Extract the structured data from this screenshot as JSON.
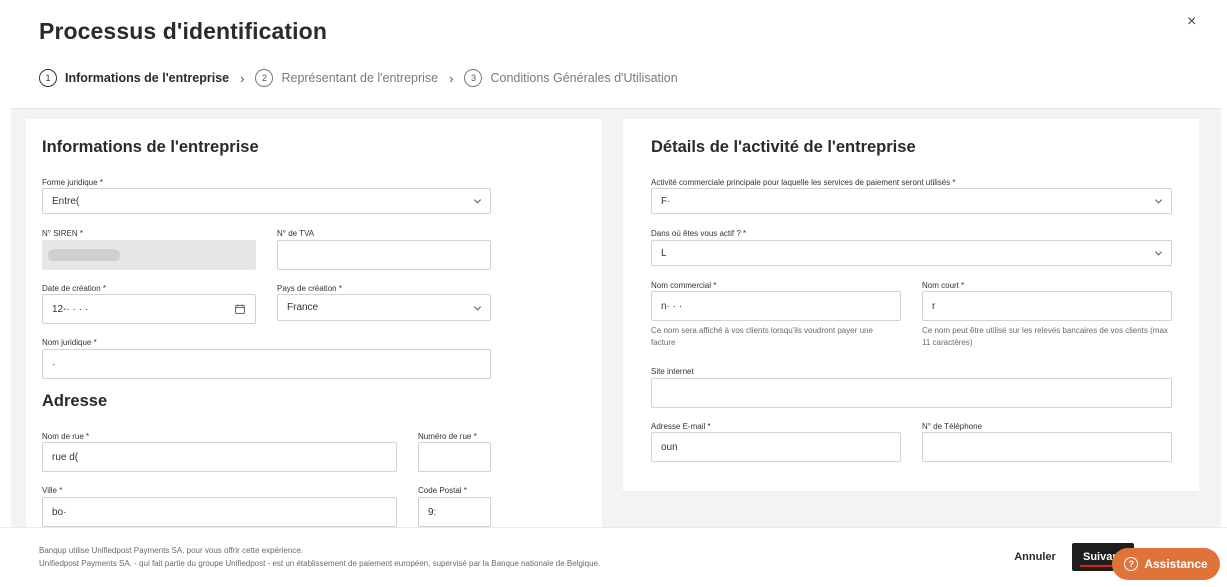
{
  "header": {
    "title": "Processus d'identification",
    "close_icon": "×"
  },
  "stepper": {
    "steps": [
      {
        "number": "1",
        "label": "Informations de l'entreprise"
      },
      {
        "number": "2",
        "label": "Représentant de l'entreprise"
      },
      {
        "number": "3",
        "label": "Conditions Générales d'Utilisation"
      }
    ],
    "separator": "›"
  },
  "company_info": {
    "title": "Informations de l'entreprise",
    "legal_form": {
      "label": "Forme juridique *",
      "value": "Entre("
    },
    "siren": {
      "label": "N° SIREN *",
      "value": ""
    },
    "vat": {
      "label": "N° de TVA",
      "value": ""
    },
    "creation_date": {
      "label": "Date de création *",
      "value": "12-·  ·  · ·"
    },
    "creation_country": {
      "label": "Pays de création *",
      "value": "France"
    },
    "legal_name": {
      "label": "Nom juridique *",
      "value": "·"
    }
  },
  "address": {
    "title": "Adresse",
    "street_name": {
      "label": "Nom de rue *",
      "value": "rue d("
    },
    "street_number": {
      "label": "Numéro de rue *",
      "value": ""
    },
    "city": {
      "label": "Ville *",
      "value": "bo·"
    },
    "postal_code": {
      "label": "Code Postal *",
      "value": "9:"
    }
  },
  "activity": {
    "title": "Détails de l'activité de l'entreprise",
    "main_activity": {
      "label": "Activité commerciale principale pour laquelle les services de paiement seront utilisés *",
      "value": "F·"
    },
    "active_where": {
      "label": "Dans où êtes vous actif ? *",
      "value": "L"
    },
    "trade_name": {
      "label": "Nom commercial *",
      "value": "n·  ·  ·",
      "help": "Ce nom sera affiché à vos clients lorsqu'ils voudront payer une facture"
    },
    "short_name": {
      "label": "Nom court *",
      "value": "r",
      "help": "Ce nom peut être utilisé sur les relevés bancaires de vos clients (max 11 caractères)"
    },
    "website": {
      "label": "Site internet",
      "value": ""
    },
    "email": {
      "label": "Adresse E-mail *",
      "value": "oun"
    },
    "phone": {
      "label": "N° de Téléphone",
      "value": ""
    }
  },
  "footer": {
    "legal_line1": "Banqup utilise Unifiedpost Payments SA. pour vous offrir cette expérience.",
    "legal_line2": "Unifiedpost Payments SA. - qui fait partie du groupe Unifiedpost - est un établissement de paiement européen, supervisé par la Banque nationale de Belgique.",
    "cancel_label": "Annuler",
    "next_label": "Suivant",
    "assistance_label": "Assistance"
  },
  "colors": {
    "accent": "#e0733a",
    "primary_button": "#1e1e1e",
    "underline": "#d6221b",
    "panel_bg": "#f3f3f3"
  }
}
